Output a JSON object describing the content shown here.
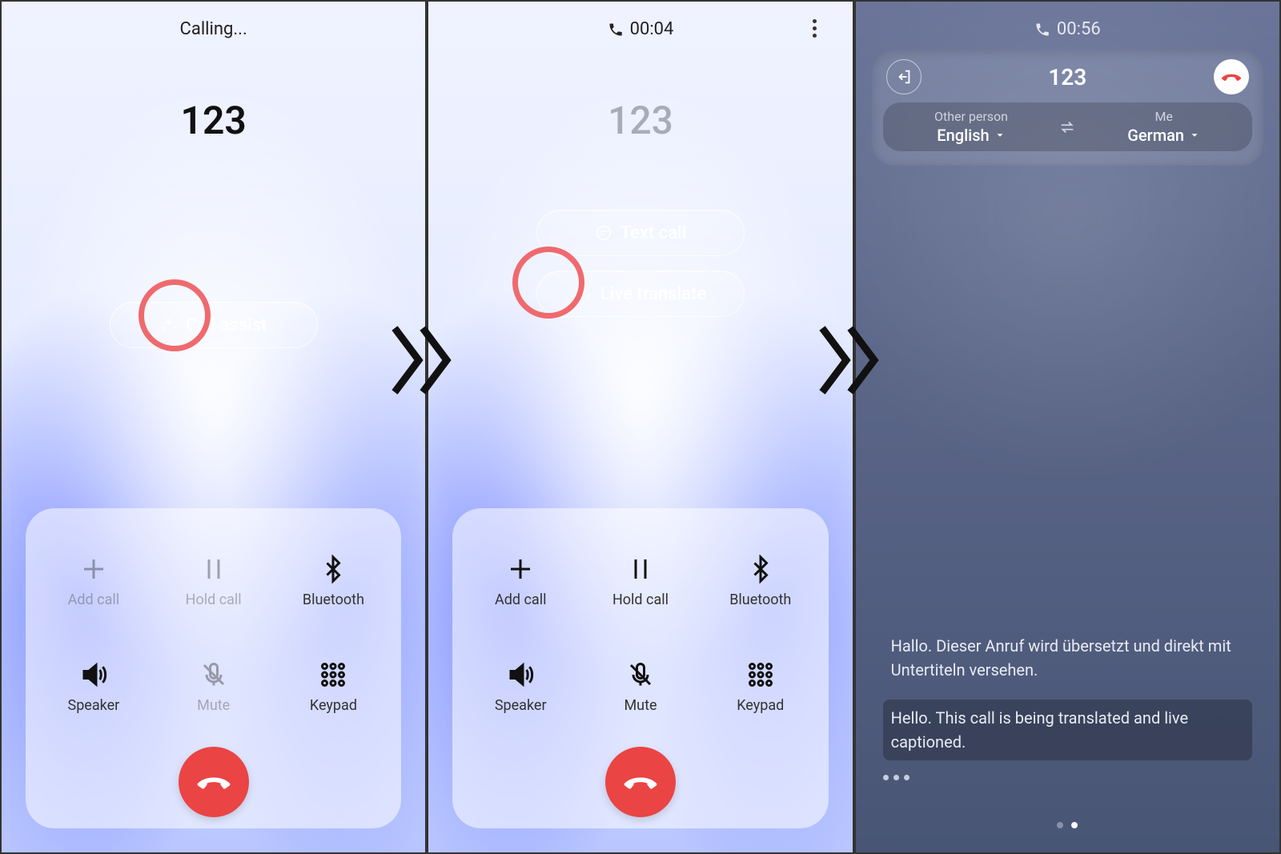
{
  "screen1": {
    "status": "Calling...",
    "number": "123",
    "call_assist_label": "Call assist",
    "controls": {
      "add_call": "Add call",
      "hold_call": "Hold call",
      "bluetooth": "Bluetooth",
      "speaker": "Speaker",
      "mute": "Mute",
      "keypad": "Keypad"
    }
  },
  "screen2": {
    "timer": "00:04",
    "number": "123",
    "text_call_label": "Text call",
    "live_translate_label": "Live translate",
    "controls": {
      "add_call": "Add call",
      "hold_call": "Hold call",
      "bluetooth": "Bluetooth",
      "speaker": "Speaker",
      "mute": "Mute",
      "keypad": "Keypad"
    }
  },
  "screen3": {
    "timer": "00:56",
    "number": "123",
    "other_label": "Other person",
    "other_lang": "English",
    "me_label": "Me",
    "me_lang": "German",
    "transcript_original": "Hallo. Dieser Anruf wird übersetzt und direkt mit Untertiteln versehen.",
    "transcript_translated": "Hello. This call is being translated and live captioned."
  }
}
